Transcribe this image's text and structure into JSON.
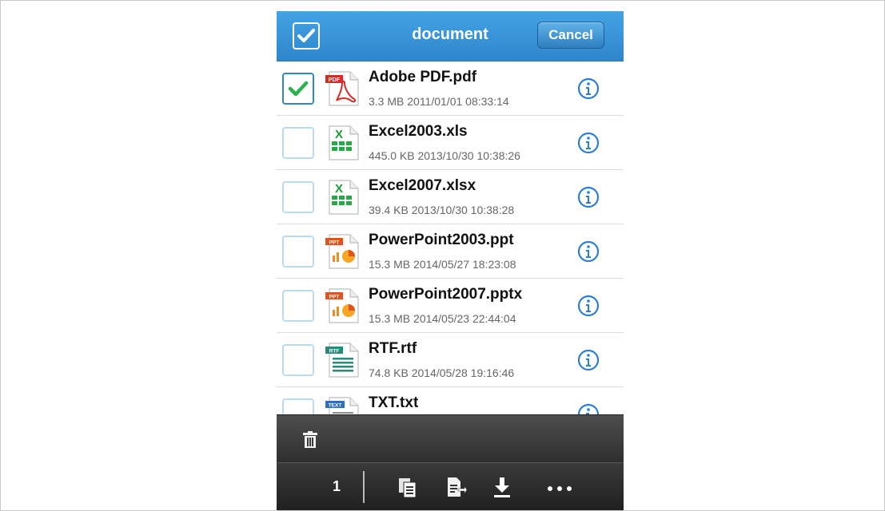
{
  "header": {
    "title": "document",
    "cancel_label": "Cancel"
  },
  "files": [
    {
      "name": "Adobe PDF.pdf",
      "meta": "3.3 MB 2011/01/01 08:33:14",
      "type": "pdf",
      "badge": "PDF",
      "checked": true
    },
    {
      "name": "Excel2003.xls",
      "meta": "445.0 KB 2013/10/30 10:38:26",
      "type": "excel",
      "badge": "X",
      "checked": false
    },
    {
      "name": "Excel2007.xlsx",
      "meta": "39.4 KB 2013/10/30 10:38:28",
      "type": "excel",
      "badge": "X",
      "checked": false
    },
    {
      "name": "PowerPoint2003.ppt",
      "meta": "15.3 MB 2014/05/27 18:23:08",
      "type": "ppt",
      "badge": "PPT",
      "checked": false
    },
    {
      "name": "PowerPoint2007.pptx",
      "meta": "15.3 MB 2014/05/23 22:44:04",
      "type": "ppt",
      "badge": "PPT",
      "checked": false
    },
    {
      "name": "RTF.rtf",
      "meta": "74.8 KB 2014/05/28 19:16:46",
      "type": "rtf",
      "badge": "RTF",
      "checked": false
    },
    {
      "name": "TXT.txt",
      "meta": "",
      "type": "txt",
      "badge": "TEXT",
      "checked": false
    }
  ],
  "toolbar": {
    "selected_count": "1",
    "icons": [
      "trash-icon",
      "copy-icon",
      "move-icon",
      "download-icon",
      "more-icon"
    ]
  },
  "colors": {
    "header_blue": "#2f86cb",
    "checkbox_border": "#b9dcf2",
    "check_green": "#2bb24c",
    "info_blue": "#2a7fd4",
    "toolbar_dark": "#2e2e2e"
  }
}
